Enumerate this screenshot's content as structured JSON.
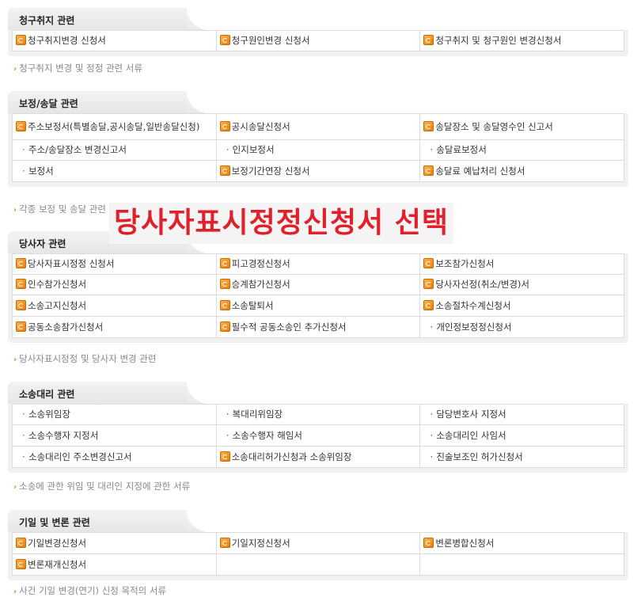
{
  "sections": [
    {
      "title": "청구취지 관련",
      "rows": [
        [
          {
            "t": "청구취지변경 신청서",
            "icon": true
          },
          {
            "t": "청구원인변경 신청서",
            "icon": true
          },
          {
            "t": "청구취지 및 청구원인 변경신청서",
            "icon": true
          }
        ]
      ],
      "related": "청구취지 변경 및 정정 관련 서류"
    },
    {
      "title": "보정/송달 관련",
      "rows": [
        [
          {
            "t": "주소보정서(특별송달,공시송달,일반송달신청)",
            "icon": true
          },
          {
            "t": "공시송달신청서",
            "icon": true
          },
          {
            "t": "송달장소 및 송달영수인 신고서",
            "icon": true
          }
        ],
        [
          {
            "t": "주소/송달장소 변경신고서",
            "icon": false
          },
          {
            "t": "인지보정서",
            "icon": false
          },
          {
            "t": "송달료보정서",
            "icon": false
          }
        ],
        [
          {
            "t": "보정서",
            "icon": false
          },
          {
            "t": "보정기간연장 신청서",
            "icon": true
          },
          {
            "t": "송달료 예납처리 신청서",
            "icon": true
          }
        ]
      ],
      "related": "각종 보정 및 송달 관련 서류"
    },
    {
      "title": "당사자 관련",
      "rows": [
        [
          {
            "t": "당사자표시정정 신청서",
            "icon": true
          },
          {
            "t": "피고경정신청서",
            "icon": true
          },
          {
            "t": "보조참가신청서",
            "icon": true
          }
        ],
        [
          {
            "t": "인수참가신청서",
            "icon": true
          },
          {
            "t": "승계참가신청서",
            "icon": true
          },
          {
            "t": "당사자선정(취소/변경)서",
            "icon": true
          }
        ],
        [
          {
            "t": "소송고지신청서",
            "icon": true
          },
          {
            "t": "소송탈퇴서",
            "icon": true
          },
          {
            "t": "소송절차수계신청서",
            "icon": true
          }
        ],
        [
          {
            "t": "공동소송참가신청서",
            "icon": true
          },
          {
            "t": "필수적 공동소송인 추가신청서",
            "icon": true
          },
          {
            "t": "개인정보정정신청서",
            "icon": false
          }
        ]
      ],
      "related": "당사자표시정정 및 당사자 변경 관련"
    },
    {
      "title": "소송대리 관련",
      "rows": [
        [
          {
            "t": "소송위임장",
            "icon": false
          },
          {
            "t": "복대리위임장",
            "icon": false
          },
          {
            "t": "담당변호사 지정서",
            "icon": false
          }
        ],
        [
          {
            "t": "소송수행자 지정서",
            "icon": false
          },
          {
            "t": "소송수행자 해임서",
            "icon": false
          },
          {
            "t": "소송대리인 사임서",
            "icon": false
          }
        ],
        [
          {
            "t": "소송대리인 주소변경신고서",
            "icon": false
          },
          {
            "t": "소송대리허가신청과 소송위임장",
            "icon": true
          },
          {
            "t": "진술보조인 허가신청서",
            "icon": false
          }
        ]
      ],
      "related": "소송에 관한 위임 및 대리인 지정에 관한 서류"
    },
    {
      "title": "기일 및 변론 관련",
      "rows": [
        [
          {
            "t": "기일변경신청서",
            "icon": true
          },
          {
            "t": "기일지정신청서",
            "icon": true
          },
          {
            "t": "변론병합신청서",
            "icon": true
          }
        ],
        [
          {
            "t": "변론재개신청서",
            "icon": true
          },
          {
            "t": "",
            "icon": false
          },
          {
            "t": "",
            "icon": false
          }
        ]
      ],
      "related": "사건 기일 변경(연기) 신청 목적의 서류"
    }
  ],
  "overlay_text": "당사자표시정정신청서 선택",
  "colors": {
    "overlay": "#e0212b",
    "icon": "#e87d0d",
    "arrow": "#7cb342"
  }
}
